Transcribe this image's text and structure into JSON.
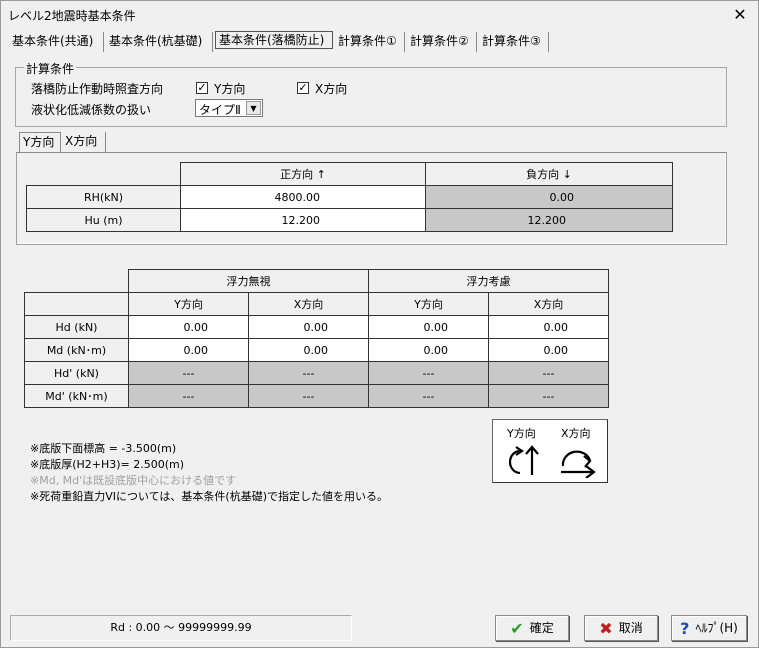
{
  "window": {
    "title": "レベル2地震時基本条件"
  },
  "tabs": [
    {
      "label": "基本条件(共通)",
      "active": false
    },
    {
      "label": "基本条件(杭基礎)",
      "active": false
    },
    {
      "label": "基本条件(落橋防止)",
      "active": true
    },
    {
      "label": "計算条件①",
      "active": false
    },
    {
      "label": "計算条件②",
      "active": false
    },
    {
      "label": "計算条件③",
      "active": false
    }
  ],
  "calc_conditions": {
    "legend": "計算条件",
    "direction_label": "落橋防止作動時照査方向",
    "y_direction": {
      "label": "Y方向",
      "checked": true
    },
    "x_direction": {
      "label": "X方向",
      "checked": true
    },
    "liquefaction_label": "液状化低減係数の扱い",
    "liquefaction_value": "タイプⅡ"
  },
  "subtabs": [
    {
      "label": "Y方向",
      "active": true
    },
    {
      "label": "X方向",
      "active": false
    }
  ],
  "rh_table": {
    "col_headers": [
      "正方向 ↑",
      "負方向 ↓"
    ],
    "rows": [
      {
        "label": "RH(kN)",
        "positive": "4800.00",
        "negative": "0.00"
      },
      {
        "label": "Hu (m)",
        "positive": "12.200",
        "negative": "12.200"
      }
    ]
  },
  "moment_table": {
    "group_headers": [
      "浮力無視",
      "浮力考慮"
    ],
    "sub_headers": [
      "Y方向",
      "X方向",
      "Y方向",
      "X方向"
    ],
    "rows": [
      {
        "label": "Hd (kN)",
        "values": [
          "0.00",
          "0.00",
          "0.00",
          "0.00"
        ],
        "editable": true
      },
      {
        "label": "Md (kN･m)",
        "values": [
          "0.00",
          "0.00",
          "0.00",
          "0.00"
        ],
        "editable": true
      },
      {
        "label": "Hd' (kN)",
        "values": [
          "---",
          "---",
          "---",
          "---"
        ],
        "editable": false
      },
      {
        "label": "Md' (kN･m)",
        "values": [
          "---",
          "---",
          "---",
          "---"
        ],
        "editable": false
      }
    ]
  },
  "notes": {
    "line1": "※底版下面標高 = -3.500(m)",
    "line2": "※底版厚(H2+H3)= 2.500(m)",
    "line3": "※Md, Md'は既設底版中心における値です",
    "line4": "※死荷重鉛直力VIについては、基本条件(杭基礎)で指定した値を用いる。"
  },
  "direction_legend": {
    "y_label": "Y方向",
    "x_label": "X方向"
  },
  "status": {
    "text": "Rd : 0.00 ～ 99999999.99"
  },
  "buttons": {
    "ok": "確定",
    "cancel": "取消",
    "help": "ﾍﾙﾌﾟ(H)"
  },
  "colors": {
    "gray_cell": "#c8c8c8",
    "ok_check": "#2a9a2a",
    "cancel_x": "#c02020",
    "help_q": "#1c4fb5"
  }
}
